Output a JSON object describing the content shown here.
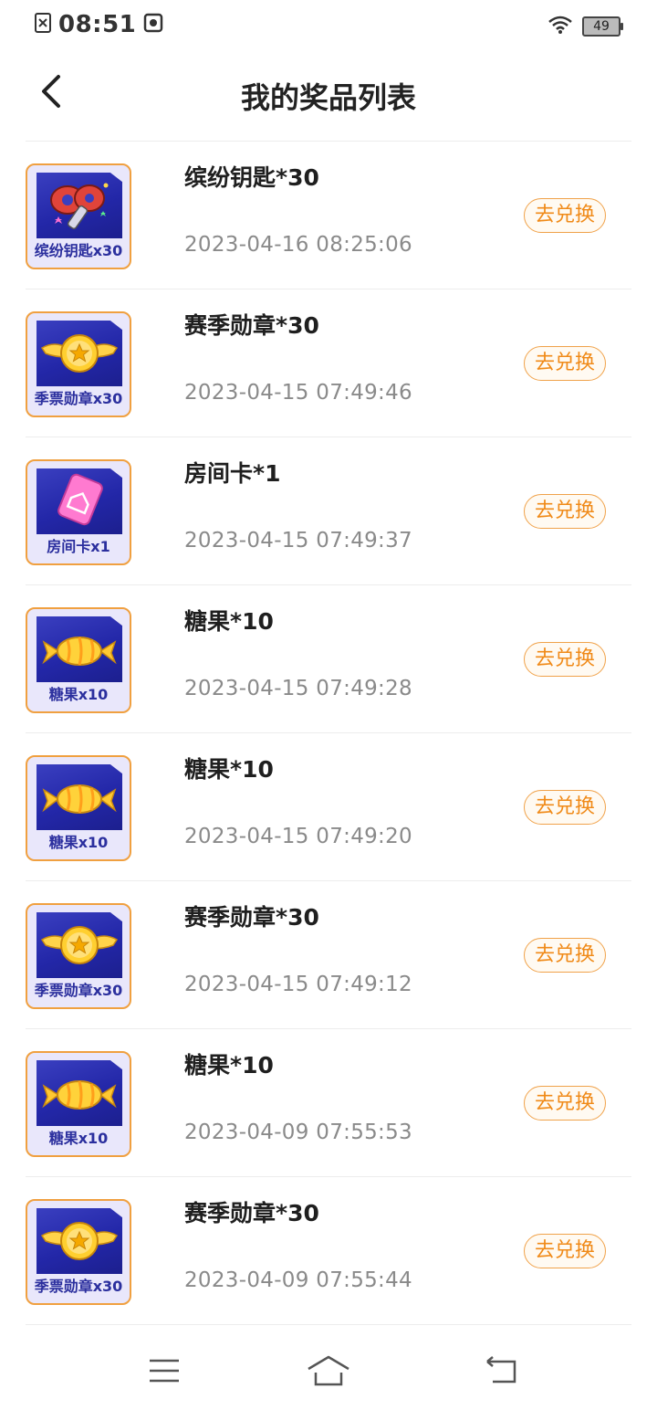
{
  "status_bar": {
    "time": "08:51",
    "battery": "49"
  },
  "header": {
    "title": "我的奖品列表"
  },
  "prizes": [
    {
      "name": "缤纷钥匙*30",
      "time": "2023-04-16 08:25:06",
      "thumb_label": "缤纷钥匙x30",
      "icon": "key-icon",
      "action": "去兑换"
    },
    {
      "name": "赛季勋章*30",
      "time": "2023-04-15 07:49:46",
      "thumb_label": "季票勋章x30",
      "icon": "medal-icon",
      "action": "去兑换"
    },
    {
      "name": "房间卡*1",
      "time": "2023-04-15 07:49:37",
      "thumb_label": "房间卡x1",
      "icon": "room-card-icon",
      "action": "去兑换"
    },
    {
      "name": "糖果*10",
      "time": "2023-04-15 07:49:28",
      "thumb_label": "糖果x10",
      "icon": "candy-icon",
      "action": "去兑换"
    },
    {
      "name": "糖果*10",
      "time": "2023-04-15 07:49:20",
      "thumb_label": "糖果x10",
      "icon": "candy-icon",
      "action": "去兑换"
    },
    {
      "name": "赛季勋章*30",
      "time": "2023-04-15 07:49:12",
      "thumb_label": "季票勋章x30",
      "icon": "medal-icon",
      "action": "去兑换"
    },
    {
      "name": "糖果*10",
      "time": "2023-04-09 07:55:53",
      "thumb_label": "糖果x10",
      "icon": "candy-icon",
      "action": "去兑换"
    },
    {
      "name": "赛季勋章*30",
      "time": "2023-04-09 07:55:44",
      "thumb_label": "季票勋章x30",
      "icon": "medal-icon",
      "action": "去兑换"
    }
  ],
  "colors": {
    "accent": "#f08a18",
    "thumb_border": "#f0a040",
    "thumb_bg": "#2327a8"
  }
}
